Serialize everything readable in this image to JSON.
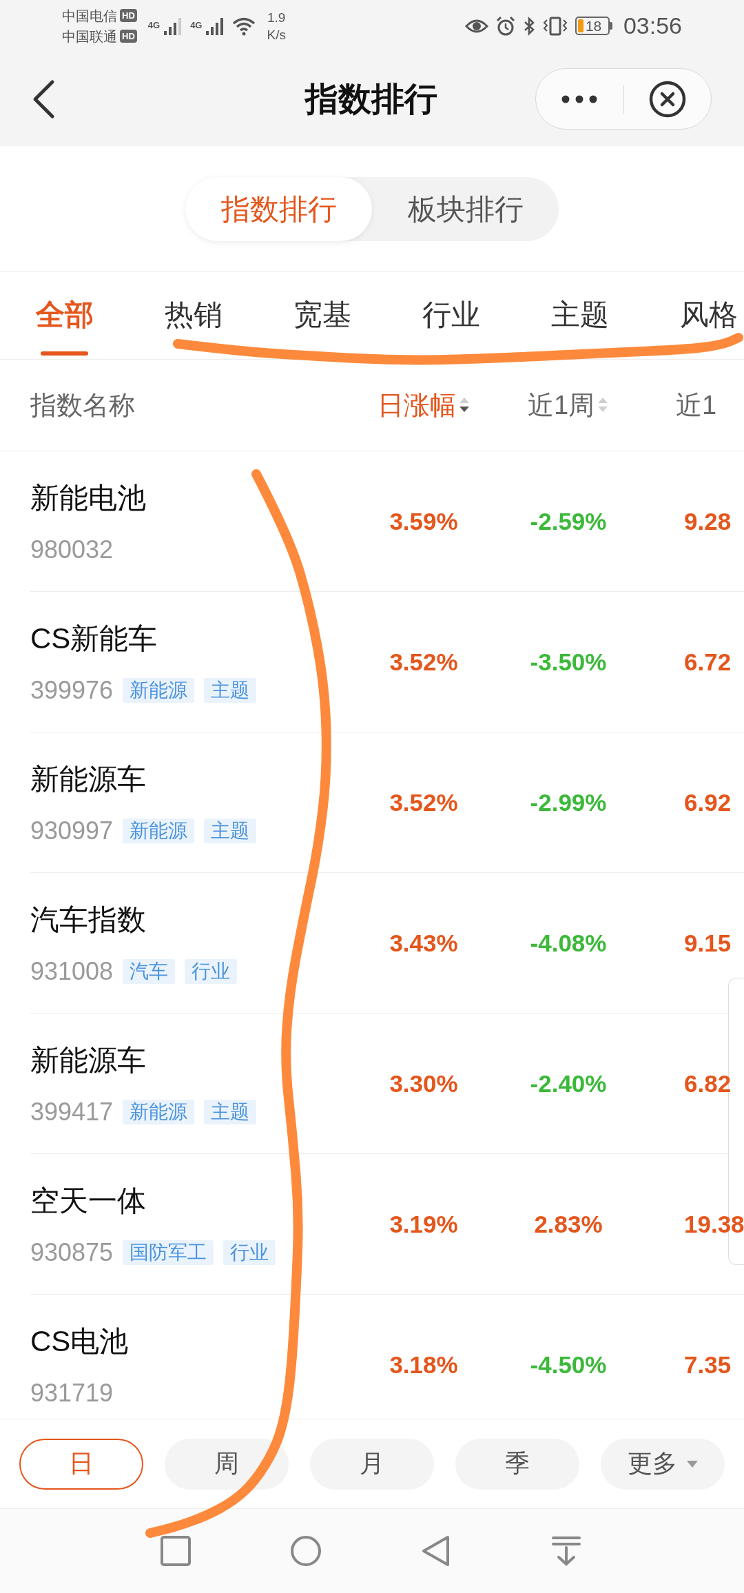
{
  "status_bar": {
    "carriers": [
      {
        "name": "中国电信",
        "badge": "HD"
      },
      {
        "name": "中国联通",
        "badge": "HD"
      }
    ],
    "networks": [
      "4G",
      "4G"
    ],
    "speed_value": "1.9",
    "speed_unit": "K/s",
    "battery": "18",
    "time": "03:56"
  },
  "header": {
    "title": "指数排行"
  },
  "segments": [
    {
      "label": "指数排行",
      "selected": true
    },
    {
      "label": "板块排行",
      "selected": false
    }
  ],
  "tabs": [
    {
      "label": "全部",
      "selected": true
    },
    {
      "label": "热销",
      "selected": false
    },
    {
      "label": "宽基",
      "selected": false
    },
    {
      "label": "行业",
      "selected": false
    },
    {
      "label": "主题",
      "selected": false
    },
    {
      "label": "风格",
      "selected": false
    }
  ],
  "table": {
    "columns": [
      {
        "label": "指数名称"
      },
      {
        "label": "日涨幅",
        "sortable": true,
        "sorted": true
      },
      {
        "label": "近1周",
        "sortable": true,
        "sorted": false
      },
      {
        "label": "近1"
      }
    ],
    "rows": [
      {
        "name": "新能电池",
        "code": "980032",
        "values": [
          {
            "text": "3.59%",
            "rising": true
          },
          {
            "text": "-2.59%",
            "rising": false
          },
          {
            "text": "9.28",
            "rising": true
          }
        ]
      },
      {
        "name": "CS新能车",
        "code": "399976",
        "tags": [
          "新能源",
          "主题"
        ],
        "values": [
          {
            "text": "3.52%",
            "rising": true
          },
          {
            "text": "-3.50%",
            "rising": false
          },
          {
            "text": "6.72",
            "rising": true
          }
        ]
      },
      {
        "name": "新能源车",
        "code": "930997",
        "tags": [
          "新能源",
          "主题"
        ],
        "values": [
          {
            "text": "3.52%",
            "rising": true
          },
          {
            "text": "-2.99%",
            "rising": false
          },
          {
            "text": "6.92",
            "rising": true
          }
        ]
      },
      {
        "name": "汽车指数",
        "code": "931008",
        "tags": [
          "汽车",
          "行业"
        ],
        "values": [
          {
            "text": "3.43%",
            "rising": true
          },
          {
            "text": "-4.08%",
            "rising": false
          },
          {
            "text": "9.15",
            "rising": true
          }
        ]
      },
      {
        "name": "新能源车",
        "code": "399417",
        "tags": [
          "新能源",
          "主题"
        ],
        "values": [
          {
            "text": "3.30%",
            "rising": true
          },
          {
            "text": "-2.40%",
            "rising": false
          },
          {
            "text": "6.82",
            "rising": true
          }
        ]
      },
      {
        "name": "空天一体",
        "code": "930875",
        "tags": [
          "国防军工",
          "行业"
        ],
        "values": [
          {
            "text": "3.19%",
            "rising": true
          },
          {
            "text": "2.83%",
            "rising": true
          },
          {
            "text": "19.38",
            "rising": true
          }
        ]
      },
      {
        "name": "CS电池",
        "code": "931719",
        "values": [
          {
            "text": "3.18%",
            "rising": true
          },
          {
            "text": "-4.50%",
            "rising": false
          },
          {
            "text": "7.35",
            "rising": true
          }
        ]
      }
    ]
  },
  "periods": [
    {
      "label": "日",
      "selected": true,
      "kind": "option"
    },
    {
      "label": "周",
      "selected": false,
      "kind": "option"
    },
    {
      "label": "月",
      "selected": false,
      "kind": "option"
    },
    {
      "label": "季",
      "selected": false,
      "kind": "option"
    },
    {
      "label": "更多",
      "selected": false,
      "kind": "dropdown"
    }
  ]
}
